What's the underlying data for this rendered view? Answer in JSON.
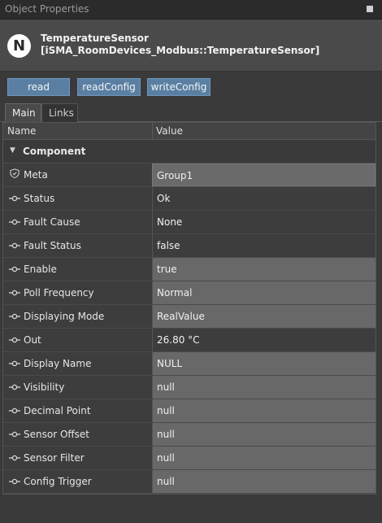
{
  "titlebar": {
    "title": "Object Properties"
  },
  "header": {
    "logo_letter": "N",
    "name": "TemperatureSensor",
    "type": "[iSMA_RoomDevices_Modbus::TemperatureSensor]"
  },
  "actions": {
    "read": "read",
    "read_config": "readConfig",
    "write_config": "writeConfig"
  },
  "tabs": [
    {
      "label": "Main"
    },
    {
      "label": "Links"
    }
  ],
  "grid": {
    "columns": [
      "Name",
      "Value"
    ],
    "group": "Component",
    "rows": [
      {
        "name": "Meta",
        "value": "Group1"
      },
      {
        "name": "Status",
        "value": "Ok"
      },
      {
        "name": "Fault Cause",
        "value": "None"
      },
      {
        "name": "Fault Status",
        "value": "false"
      },
      {
        "name": "Enable",
        "value": "true"
      },
      {
        "name": "Poll Frequency",
        "value": "Normal"
      },
      {
        "name": "Displaying Mode",
        "value": "RealValue"
      },
      {
        "name": "Out",
        "value": "26.80 °C"
      },
      {
        "name": "Display Name",
        "value": "NULL"
      },
      {
        "name": "Visibility",
        "value": "null"
      },
      {
        "name": "Decimal Point",
        "value": "null"
      },
      {
        "name": "Sensor Offset",
        "value": "null"
      },
      {
        "name": "Sensor Filter",
        "value": "null"
      },
      {
        "name": "Config Trigger",
        "value": "null"
      }
    ]
  },
  "colors": {
    "button": "#5a7fa3",
    "editable_cell": "#686868",
    "background": "#3a3a3a"
  }
}
